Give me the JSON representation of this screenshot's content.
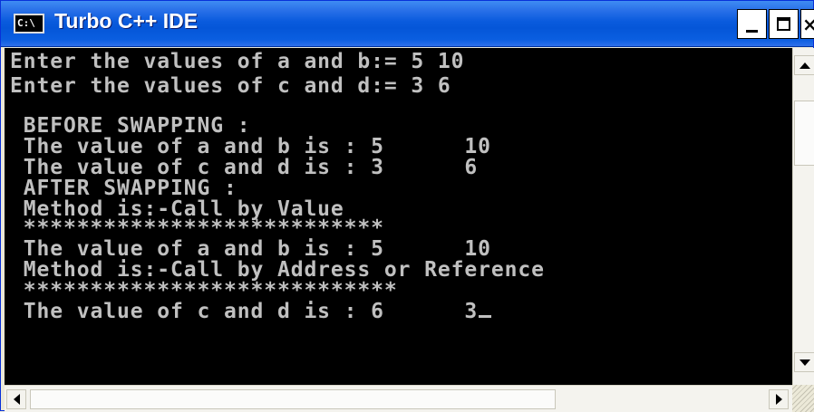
{
  "window": {
    "title": "Turbo C++ IDE",
    "icon_label": "C:\\",
    "close_glyph": "×"
  },
  "console": {
    "lines": [
      "Enter the values of a and b:= 5 10",
      "Enter the values of c and d:= 3 6",
      "",
      " BEFORE SWAPPING :",
      " The value of a and b is : 5      10",
      " The value of c and d is : 3      6",
      " AFTER SWAPPING :",
      " Method is:-Call by Value",
      " ***************************",
      " The value of a and b is : 5      10",
      " Method is:-Call by Address or Reference",
      " ****************************",
      " The value of c and d is : 6      3"
    ],
    "text_color": "#c0c0c0",
    "background": "#000000"
  },
  "colors": {
    "titlebar_blue": "#0556d8",
    "window_frame": "#ece9d8"
  }
}
